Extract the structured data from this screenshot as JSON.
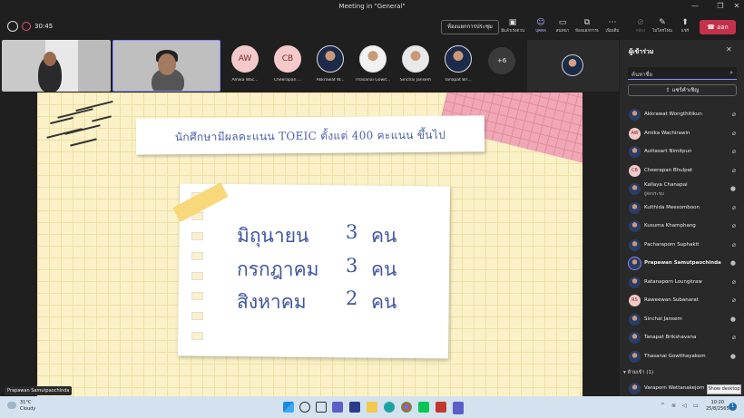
{
  "window": {
    "title": "Meeting in \"General\"",
    "controls": [
      "—",
      "❐",
      "✕"
    ]
  },
  "toolbar": {
    "timer": "30:45",
    "breakout_label": "ห้องแยกการประชุม",
    "tools": [
      {
        "icon": "whiteboard-icon",
        "glyph": "▣",
        "label": "มีแล้วเร่งด่วน",
        "state": "normal"
      },
      {
        "icon": "people-icon",
        "glyph": "👥",
        "label": "บุคคล",
        "state": "active"
      },
      {
        "icon": "chat-icon",
        "glyph": "💬",
        "label": "สนทนา",
        "state": "normal"
      },
      {
        "icon": "rooms-icon",
        "glyph": "⧉",
        "label": "ห้องแยกการประชุม",
        "state": "normal"
      },
      {
        "icon": "more-icon",
        "glyph": "⋯",
        "label": "เพิ่มเติม",
        "state": "normal"
      },
      {
        "icon": "camera-off-icon",
        "glyph": "⊘",
        "label": "กล้อง",
        "state": "dim"
      },
      {
        "icon": "mic-off-icon",
        "glyph": "🎙",
        "label": "ไมโครโฟน",
        "state": "normal"
      },
      {
        "icon": "share-icon",
        "glyph": "⬆",
        "label": "แชร์",
        "state": "normal"
      }
    ],
    "leave_label": "ออก"
  },
  "strip": {
    "attendees": [
      {
        "initials": "AW",
        "name": "Amika Wac...",
        "color": "#f4c9c9"
      },
      {
        "initials": "CB",
        "name": "Cheerapan ...",
        "color": "#f4c9c9"
      },
      {
        "initials": "",
        "name": "Akkrawat W...",
        "color": ""
      },
      {
        "initials": "",
        "name": "Thasanai Gowit...",
        "color": ""
      },
      {
        "initials": "",
        "name": "Sinchai Jansem",
        "color": ""
      },
      {
        "initials": "",
        "name": "Tanapat Bri...",
        "color": ""
      }
    ],
    "more_label": "+6"
  },
  "slide": {
    "banner": "นักศึกษามีผลคะแนน TOEIC ตั้งแต่ 400 คะแนน ขึ้นไป",
    "rows": [
      {
        "month": "มิถุนายน",
        "count": "3",
        "unit": "คน"
      },
      {
        "month": "กรกฎาคม",
        "count": "3",
        "unit": "คน"
      },
      {
        "month": "สิงหาคม",
        "count": "2",
        "unit": "คน"
      }
    ]
  },
  "presenter_caption": "Prapawan Samutpaochinda",
  "panel": {
    "title": "ผู้เข้าร่วม",
    "search_placeholder": "ค้นหาชื่อ",
    "share_invite_label": "แชร์คำเชิญ",
    "participants": [
      {
        "name": "Akkrawat Wongthitikun",
        "initials": "",
        "sub": "",
        "mic": "muted",
        "bold": false
      },
      {
        "name": "Amika Wachirawin",
        "initials": "AW",
        "sub": "",
        "mic": "muted",
        "bold": false
      },
      {
        "name": "Auttasart Nimitpun",
        "initials": "",
        "sub": "",
        "mic": "muted",
        "bold": false
      },
      {
        "name": "Cheerapan Bhulpat",
        "initials": "CB",
        "sub": "",
        "mic": "muted",
        "bold": false
      },
      {
        "name": "Kallaya Chanapai",
        "initials": "",
        "sub": "ผู้จัดประชุม",
        "mic": "on",
        "bold": false
      },
      {
        "name": "Kulthida Meesomboon",
        "initials": "",
        "sub": "",
        "mic": "muted",
        "bold": false
      },
      {
        "name": "Kusuma Khamphang",
        "initials": "",
        "sub": "",
        "mic": "muted",
        "bold": false
      },
      {
        "name": "Pacharaporn Suphakit",
        "initials": "",
        "sub": "",
        "mic": "muted",
        "bold": false
      },
      {
        "name": "Prapawan Samutpaochinda",
        "initials": "",
        "sub": "",
        "mic": "on",
        "bold": true
      },
      {
        "name": "Ratanaporn Loungkraw",
        "initials": "",
        "sub": "",
        "mic": "muted",
        "bold": false
      },
      {
        "name": "Raweewan Subanarat",
        "initials": "RS",
        "sub": "",
        "mic": "muted",
        "bold": false
      },
      {
        "name": "Sinchai Jansem",
        "initials": "",
        "sub": "",
        "mic": "on",
        "bold": false
      },
      {
        "name": "Tanapat Brikshavana",
        "initials": "",
        "sub": "",
        "mic": "muted",
        "bold": false
      },
      {
        "name": "Thasanai Gowithayakom",
        "initials": "",
        "sub": "",
        "mic": "on",
        "bold": false
      }
    ],
    "group_label": "ห้ามเข้า (1)",
    "last_participant": "Varaporn Wattanakejorn",
    "tooltip": "Show desktop"
  },
  "taskbar": {
    "temp": "31°C",
    "weather": "Cloudy",
    "time": "10:20",
    "date": "25/8/2565",
    "notifications": "1"
  }
}
